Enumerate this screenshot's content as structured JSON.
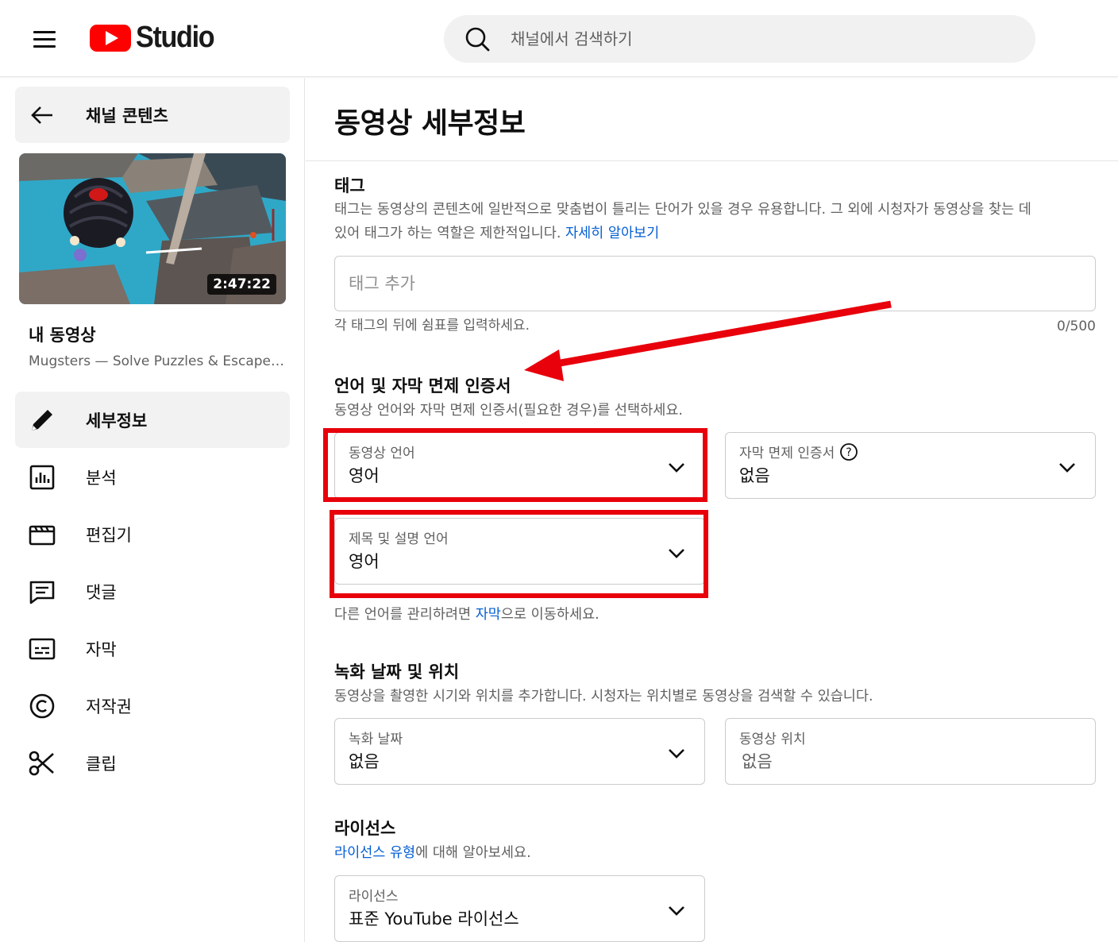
{
  "header": {
    "logo_text": "Studio",
    "search_placeholder": "채널에서 검색하기"
  },
  "sidebar": {
    "back_label": "채널 콘텐츠",
    "video": {
      "duration": "2:47:22",
      "heading": "내 동영상",
      "subtitle": "Mugsters — Solve Puzzles & Escape…"
    },
    "items": [
      {
        "label": "세부정보",
        "icon": "pencil-icon",
        "active": true
      },
      {
        "label": "분석",
        "icon": "analytics-icon"
      },
      {
        "label": "편집기",
        "icon": "clapperboard-icon"
      },
      {
        "label": "댓글",
        "icon": "comment-icon"
      },
      {
        "label": "자막",
        "icon": "subtitles-icon"
      },
      {
        "label": "저작권",
        "icon": "copyright-icon"
      },
      {
        "label": "클립",
        "icon": "scissors-icon"
      }
    ]
  },
  "main": {
    "page_title": "동영상 세부정보",
    "tags": {
      "title": "태그",
      "desc_line1": "태그는 동영상의 콘텐츠에 일반적으로 맞춤법이 틀리는 단어가 있을 경우 유용합니다. 그 외에 시청자가 동영상을 찾는 데",
      "desc_line2": "있어 태그가 하는 역할은 제한적입니다. ",
      "learn_more": "자세히 알아보기",
      "placeholder": "태그 추가",
      "hint": "각 태그의 뒤에 쉼표를 입력하세요.",
      "counter": "0/500"
    },
    "language": {
      "title": "언어 및 자막 면제 인증서",
      "desc": "동영상 언어와 자막 면제 인증서(필요한 경우)를 선택하세요.",
      "video_language_label": "동영상 언어",
      "video_language_value": "영어",
      "caption_cert_label": "자막 면제 인증서",
      "caption_cert_value": "없음",
      "title_desc_language_label": "제목 및 설명 언어",
      "title_desc_language_value": "영어",
      "manage_prefix": "다른 언어를 관리하려면 ",
      "manage_link": "자막",
      "manage_suffix": "으로 이동하세요."
    },
    "recording": {
      "title": "녹화 날짜 및 위치",
      "desc": "동영상을 촬영한 시기와 위치를 추가합니다. 시청자는 위치별로 동영상을 검색할 수 있습니다.",
      "date_label": "녹화 날짜",
      "date_value": "없음",
      "location_label": "동영상 위치",
      "location_value": "없음"
    },
    "license": {
      "title": "라이선스",
      "link": "라이선스 유형",
      "desc_suffix": "에 대해 알아보세요.",
      "field_label": "라이선스",
      "field_value": "표준 YouTube 라이선스"
    }
  },
  "colors": {
    "brand_red": "#ff0000",
    "link_blue": "#065fd4",
    "annotation_red": "#e8000b"
  }
}
